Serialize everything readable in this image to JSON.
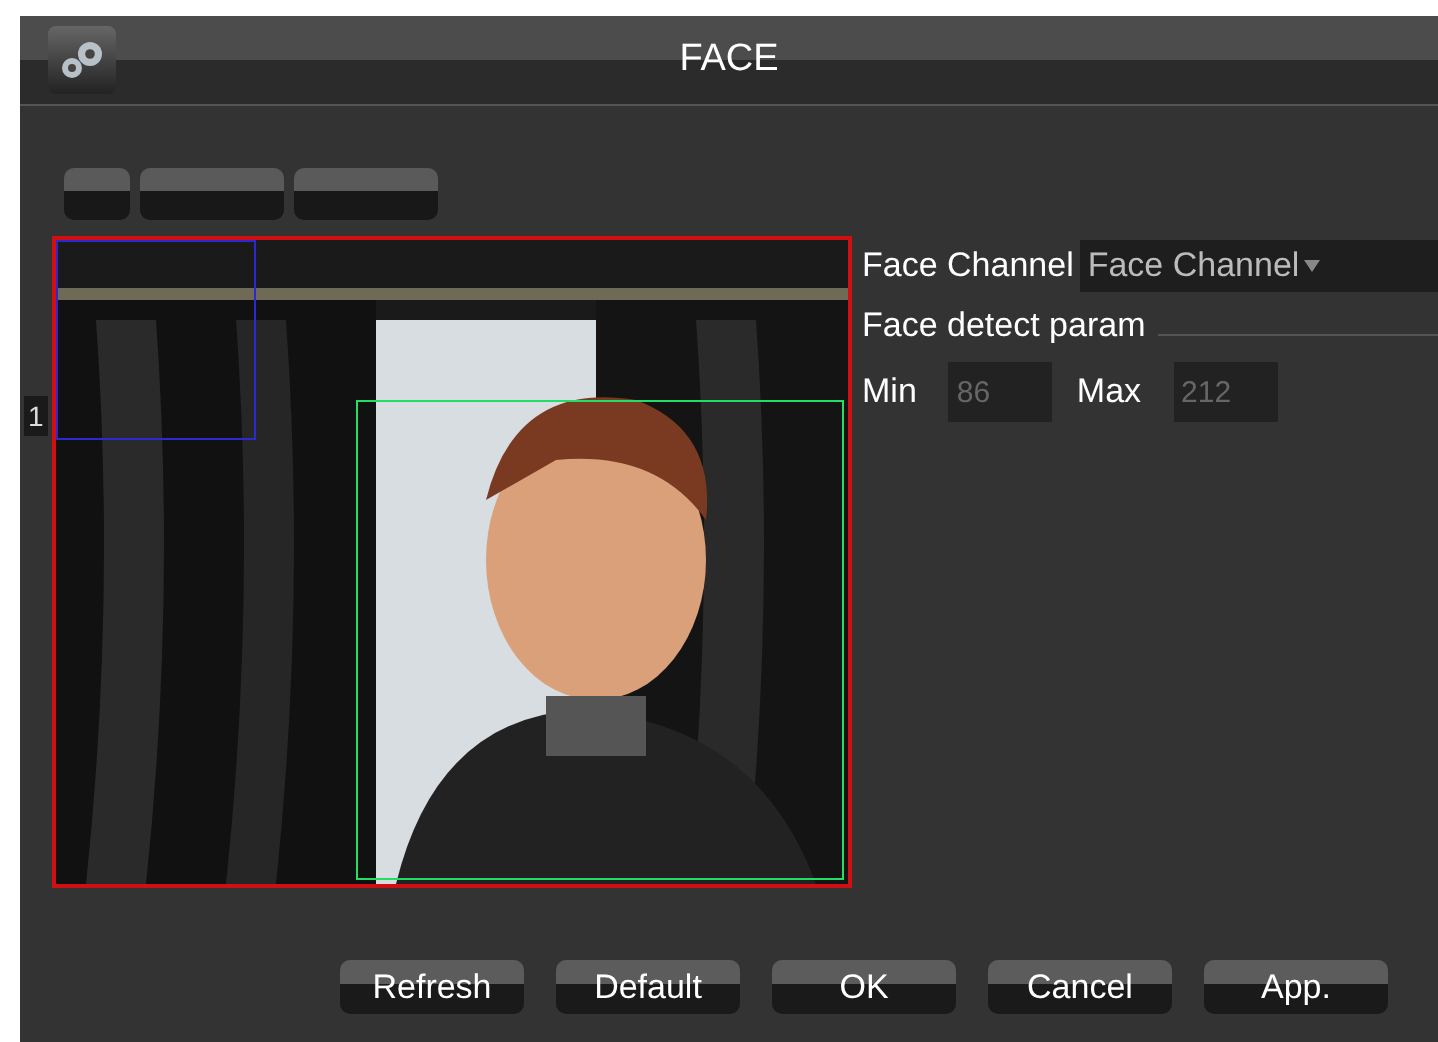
{
  "window": {
    "title": "FACE"
  },
  "tab_buttons": [
    {
      "kind": "blank"
    },
    {
      "kind": "blank"
    },
    {
      "kind": "blank"
    }
  ],
  "side_label": "1",
  "preview": {
    "kind": "picture",
    "detect_boxes": [
      {
        "color": "#2a2ad0"
      },
      {
        "color": "#22dd66"
      }
    ]
  },
  "face_channel": {
    "label": "Face Channel",
    "value": "Face Channel"
  },
  "section": "Face detect param",
  "min": {
    "label": "Min",
    "value": "86",
    "disabled": true
  },
  "max": {
    "label": "Max",
    "value": "212",
    "disabled": true
  },
  "buttons": [
    "Refresh",
    "Default",
    "OK",
    "Cancel",
    "App."
  ]
}
